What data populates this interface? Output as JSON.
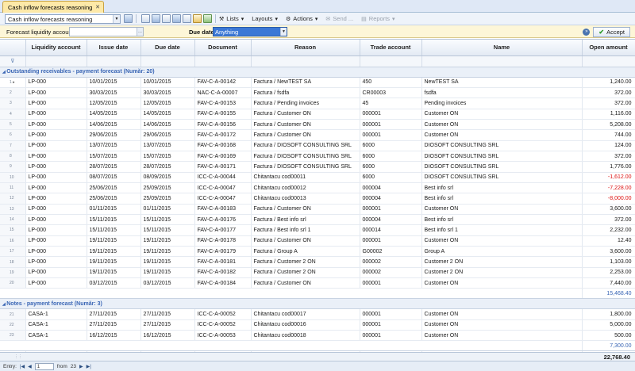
{
  "tab": {
    "title": "Cash inflow forecasts reasoning"
  },
  "toolbar": {
    "view_select": "Cash inflow forecasts reasoning",
    "lists": "Lists",
    "layouts": "Layouts",
    "actions": "Actions",
    "send": "Send ...",
    "reports": "Reports"
  },
  "filter": {
    "account_label": "Forecast liquidity account",
    "account_value": "",
    "due_label": "Due date",
    "due_value": "Anything",
    "accept": "Accept"
  },
  "columns": [
    "Liquidity account",
    "Issue date",
    "Due date",
    "Document",
    "Reason",
    "Trade account",
    "Name",
    "Open amount"
  ],
  "groups": [
    {
      "title": "Outstanding receivables - payment forecast  (Număr: 20)",
      "subtotal": "15,468.40",
      "rows": [
        [
          "1",
          "LP-000",
          "10/01/2015",
          "10/01/2015",
          "FAV-C-A-00142",
          "Factura / NewTEST SA",
          "450",
          "NewTEST SA",
          "1,240.00"
        ],
        [
          "2",
          "LP-000",
          "30/03/2015",
          "30/03/2015",
          "NAC-C-A-00007",
          "Factura / fsdfa",
          "CR00003",
          "fsdfa",
          "372.00"
        ],
        [
          "3",
          "LP-000",
          "12/05/2015",
          "12/05/2015",
          "FAV-C-A-00153",
          "Factura / Pending invoices",
          "45",
          "Pending invoices",
          "372.00"
        ],
        [
          "4",
          "LP-000",
          "14/05/2015",
          "14/05/2015",
          "FAV-C-A-00155",
          "Factura / Customer ON",
          "000001",
          "Customer ON",
          "1,116.00"
        ],
        [
          "5",
          "LP-000",
          "14/06/2015",
          "14/06/2015",
          "FAV-C-A-00156",
          "Factura / Customer ON",
          "000001",
          "Customer ON",
          "5,208.00"
        ],
        [
          "6",
          "LP-000",
          "29/06/2015",
          "29/06/2015",
          "FAV-C-A-00172",
          "Factura / Customer ON",
          "000001",
          "Customer ON",
          "744.00"
        ],
        [
          "7",
          "LP-000",
          "13/07/2015",
          "13/07/2015",
          "FAV-C-A-00168",
          "Factura / DIOSOFT CONSULTING SRL",
          "6000",
          "DIOSOFT CONSULTING SRL",
          "124.00"
        ],
        [
          "8",
          "LP-000",
          "15/07/2015",
          "15/07/2015",
          "FAV-C-A-00169",
          "Factura / DIOSOFT CONSULTING SRL",
          "6000",
          "DIOSOFT CONSULTING SRL",
          "372.00"
        ],
        [
          "9",
          "LP-000",
          "28/07/2015",
          "28/07/2015",
          "FAV-C-A-00171",
          "Factura / DIOSOFT CONSULTING SRL",
          "6000",
          "DIOSOFT CONSULTING SRL",
          "1,776.00"
        ],
        [
          "10",
          "LP-000",
          "08/07/2015",
          "08/09/2015",
          "ICC-C-A-00044",
          "Chitantacu cod00011",
          "6000",
          "DIOSOFT CONSULTING SRL",
          "-1,612.00"
        ],
        [
          "11",
          "LP-000",
          "25/06/2015",
          "25/09/2015",
          "ICC-C-A-00047",
          "Chitantacu cod00012",
          "000004",
          "Best info srl",
          "-7,228.00"
        ],
        [
          "12",
          "LP-000",
          "25/06/2015",
          "25/09/2015",
          "ICC-C-A-00047",
          "Chitantacu cod00013",
          "000004",
          "Best info srl",
          "-8,000.00"
        ],
        [
          "13",
          "LP-000",
          "01/11/2015",
          "01/11/2015",
          "FAV-C-A-00183",
          "Factura / Customer ON",
          "000001",
          "Customer ON",
          "3,600.00"
        ],
        [
          "14",
          "LP-000",
          "15/11/2015",
          "15/11/2015",
          "FAV-C-A-00176",
          "Factura / Best info srl",
          "000004",
          "Best info srl",
          "372.00"
        ],
        [
          "15",
          "LP-000",
          "15/11/2015",
          "15/11/2015",
          "FAV-C-A-00177",
          "Factura / Best info srl  1",
          "000014",
          "Best info srl  1",
          "2,232.00"
        ],
        [
          "16",
          "LP-000",
          "19/11/2015",
          "19/11/2015",
          "FAV-C-A-00178",
          "Factura / Customer ON",
          "000001",
          "Customer ON",
          "12.40"
        ],
        [
          "17",
          "LP-000",
          "19/11/2015",
          "19/11/2015",
          "FAV-C-A-00179",
          "Factura / Group A",
          "G00002",
          "Group A",
          "3,600.00"
        ],
        [
          "18",
          "LP-000",
          "19/11/2015",
          "19/11/2015",
          "FAV-C-A-00181",
          "Factura / Customer 2 ON",
          "000002",
          "Customer 2 ON",
          "1,103.00"
        ],
        [
          "19",
          "LP-000",
          "19/11/2015",
          "19/11/2015",
          "FAV-C-A-00182",
          "Factura / Customer 2 ON",
          "000002",
          "Customer 2 ON",
          "2,253.00"
        ],
        [
          "20",
          "LP-000",
          "03/12/2015",
          "03/12/2015",
          "FAV-C-A-00184",
          "Factura / Customer ON",
          "000001",
          "Customer ON",
          "7,440.00"
        ]
      ]
    },
    {
      "title": "Notes - payment forecast  (Număr: 3)",
      "subtotal": "7,300.00",
      "rows": [
        [
          "21",
          "CASA-1",
          "27/11/2015",
          "27/11/2015",
          "ICC-C-A-00052",
          "Chitantacu cod00017",
          "000001",
          "Customer ON",
          "1,800.00"
        ],
        [
          "22",
          "CASA-1",
          "27/11/2015",
          "27/11/2015",
          "ICC-C-A-00052",
          "Chitantacu cod00016",
          "000001",
          "Customer ON",
          "5,000.00"
        ],
        [
          "23",
          "CASA-1",
          "16/12/2015",
          "16/12/2015",
          "ICC-C-A-00053",
          "Chitantacu cod00018",
          "000001",
          "Customer ON",
          "500.00"
        ]
      ]
    }
  ],
  "total": "22,768.40",
  "pager": {
    "entry_label": "Entry:",
    "current": "1",
    "from_label": "from",
    "count": "23"
  },
  "colors": {
    "accent": "#3a66b5",
    "negative": "#dd1111",
    "tab": "#fde9a8"
  }
}
